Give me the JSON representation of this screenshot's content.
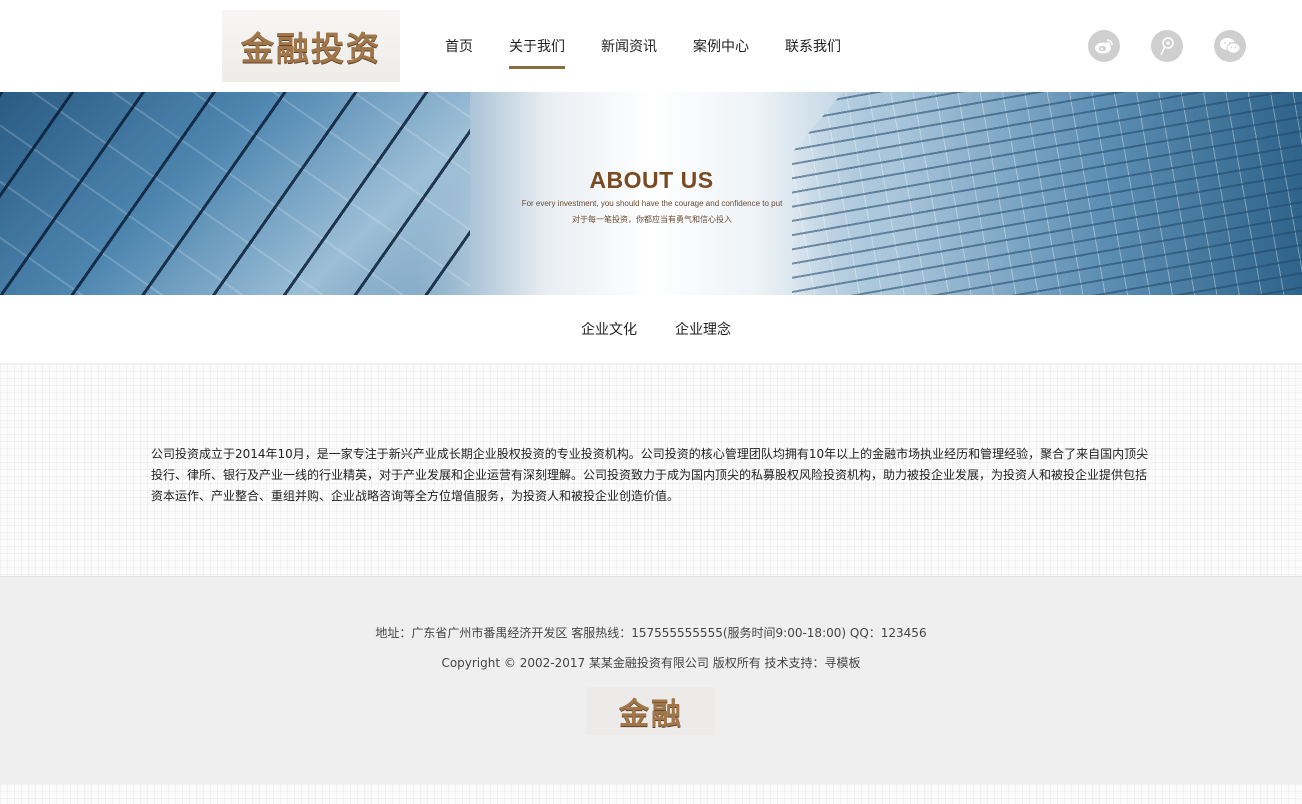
{
  "header": {
    "logo_text": "金融投资",
    "nav": [
      {
        "label": "首页",
        "active": false
      },
      {
        "label": "关于我们",
        "active": true
      },
      {
        "label": "新闻资讯",
        "active": false
      },
      {
        "label": "案例中心",
        "active": false
      },
      {
        "label": "联系我们",
        "active": false
      }
    ],
    "social": [
      {
        "icon": "weibo-icon"
      },
      {
        "icon": "tencent-weibo-icon"
      },
      {
        "icon": "wechat-icon"
      }
    ],
    "accent_color": "#8b6b45"
  },
  "banner": {
    "title": "ABOUT US",
    "subtitle_en": "For every investment, you should have the courage and confidence to put",
    "subtitle_cn": "对于每一笔投资，你都应当有勇气和信心投入"
  },
  "subnav": {
    "items": [
      {
        "label": "企业文化"
      },
      {
        "label": "企业理念"
      }
    ]
  },
  "content": {
    "intro": "公司投资成立于2014年10月，是一家专注于新兴产业成长期企业股权投资的专业投资机构。公司投资的核心管理团队均拥有10年以上的金融市场执业经历和管理经验，聚合了来自国内顶尖投行、律所、银行及产业一线的行业精英，对于产业发展和企业运营有深刻理解。公司投资致力于成为国内顶尖的私募股权风险投资机构，助力被投企业发展，为投资人和被投企业提供包括资本运作、产业整合、重组并购、企业战略咨询等全方位增值服务，为投资人和被投企业创造价值。"
  },
  "footer": {
    "address": "地址：广东省广州市番禺经济开发区 客服热线：157555555555(服务时间9:00-18:00) QQ：123456",
    "copyright": "Copyright © 2002-2017 某某金融投资有限公司 版权所有 技术支持：寻模板",
    "logo_text": "金融"
  }
}
